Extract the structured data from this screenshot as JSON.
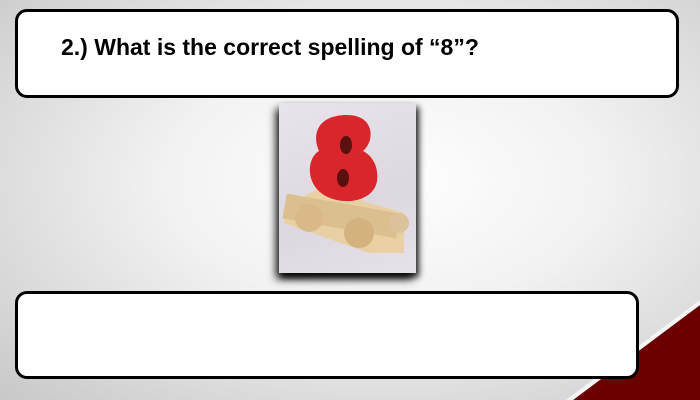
{
  "question": {
    "text": "2.) What is the correct spelling of “8”?"
  },
  "answer": {
    "value": ""
  },
  "image": {
    "description_icon": "number-eight-toy-train-image"
  },
  "colors": {
    "accent": "#6b0000"
  }
}
